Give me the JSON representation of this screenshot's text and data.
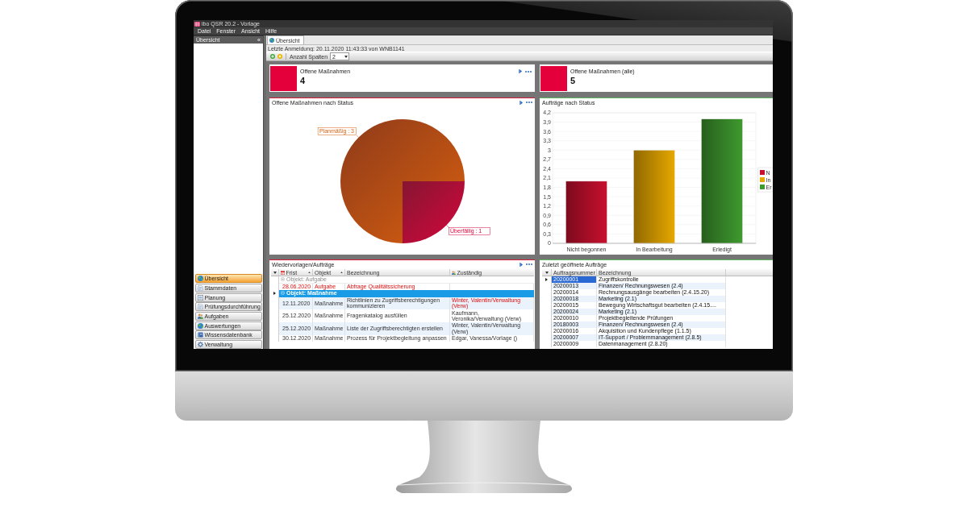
{
  "window": {
    "title": "ibo QSR 20.2 - Vorlage"
  },
  "menu": [
    "Datei",
    "Fenster",
    "Ansicht",
    "Hilfe"
  ],
  "sidebar": {
    "title": "Übersicht",
    "collapse": "«",
    "items": [
      {
        "label": "Übersicht",
        "selected": true
      },
      {
        "label": "Stammdaten",
        "selected": false
      },
      {
        "label": "Planung",
        "selected": false
      },
      {
        "label": "Prüfungsdurchführung",
        "selected": false
      },
      {
        "label": "Aufgaben",
        "selected": false
      },
      {
        "label": "Auswertungen",
        "selected": false
      },
      {
        "label": "Wissensdatenbank",
        "selected": false
      },
      {
        "label": "Verwaltung",
        "selected": false
      }
    ]
  },
  "tabs": [
    {
      "label": "Übersicht",
      "selected": true
    }
  ],
  "login_info": "Letzte Anmeldung: 20.11.2020 11:43:33 von WNB1141",
  "toolbar": {
    "columns_label": "Anzahl Spalten",
    "columns_value": "2"
  },
  "widgets": [
    {
      "kind": "count",
      "title": "Offene Maßnahmen",
      "value": "4",
      "actions": true
    },
    {
      "kind": "count",
      "title": "Offene Maßnahmen (alle)",
      "value": "5",
      "actions": false
    },
    {
      "kind": "chart",
      "title": "Offene Maßnahmen nach Status",
      "color": "#d21c3c",
      "actions": true,
      "chart_data": {
        "type": "pie",
        "categories": [
          "Planmäßig",
          "Überfällig"
        ],
        "values": [
          3,
          1
        ],
        "value_labels": [
          ": 3",
          ": 1"
        ]
      }
    },
    {
      "kind": "chart",
      "title": "Aufträge nach Status",
      "color": "#5cb85c",
      "actions": false,
      "chart_data": {
        "type": "bar",
        "categories": [
          "Nicht begonnen",
          "In Bearbeitung",
          "Erledigt"
        ],
        "values": [
          2,
          3,
          4
        ],
        "ylim": [
          0,
          4.2
        ],
        "grid": true,
        "yticks": [
          {
            "value": 0,
            "label": "0"
          },
          {
            "value": 0.3,
            "label": "0,3"
          },
          {
            "value": 0.6,
            "label": "0,6"
          },
          {
            "value": 0.9,
            "label": "0,9"
          },
          {
            "value": 1.2,
            "label": "1,2"
          },
          {
            "value": 1.5,
            "label": "1,5"
          },
          {
            "value": 1.8,
            "label": "1,8"
          },
          {
            "value": 2.1,
            "label": "2,1"
          },
          {
            "value": 2.4,
            "label": "2,4"
          },
          {
            "value": 2.7,
            "label": "2,7"
          },
          {
            "value": 3,
            "label": "3"
          },
          {
            "value": 3.3,
            "label": "3,3"
          },
          {
            "value": 3.6,
            "label": "3,6"
          },
          {
            "value": 3.9,
            "label": "3,9"
          },
          {
            "value": 4.2,
            "label": "4,2"
          }
        ]
      },
      "legend": [
        {
          "label": "N",
          "color": "#c8102e"
        },
        {
          "label": "In",
          "color": "#e6a800"
        },
        {
          "label": "Er",
          "color": "#3f9a2f"
        }
      ]
    },
    {
      "kind": "grouped_table",
      "title": "Wiedervorlagen/Aufträge",
      "color": "#d21c3c",
      "actions": true,
      "columns": [
        {
          "label": "Frist",
          "sorted": true
        },
        {
          "label": "Objekt",
          "sorted": true
        },
        {
          "label": "Bezeichnung",
          "sorted": false
        },
        {
          "label": "Zuständig",
          "sorted": false
        }
      ],
      "groups": [
        {
          "label": "Objekt: Aufgabe",
          "expanded": true,
          "selected": false,
          "rows": [
            {
              "cells": [
                {
                  "text": "28.06.2020",
                  "alert": true
                },
                {
                  "text": "Aufgabe",
                  "alert": true
                },
                {
                  "text": "Abfrage Qualitätssicherung",
                  "alert": true
                }
              ]
            }
          ]
        },
        {
          "label": "Objekt: Maßnahme",
          "expanded": true,
          "selected": true,
          "rows": [
            {
              "cells": [
                {
                  "text": "12.11.2020",
                  "alert": false
                },
                {
                  "text": "Maßnahme",
                  "alert": false
                },
                {
                  "text": "Richtlinien zu Zugriffsberechtigungen kommunizieren",
                  "alert": false
                },
                {
                  "text": "Winter, Valentin/Verwaltung (Verw)",
                  "alert": true
                }
              ]
            },
            {
              "cells": [
                {
                  "text": "25.12.2020",
                  "alert": false
                },
                {
                  "text": "Maßnahme",
                  "alert": false
                },
                {
                  "text": "Fragenkatalog ausfüllen",
                  "alert": false
                },
                {
                  "text": "Kaufmann, Veronika/Verwaltung (Verw)",
                  "alert": false
                }
              ]
            },
            {
              "cells": [
                {
                  "text": "25.12.2020",
                  "alert": false
                },
                {
                  "text": "Maßnahme",
                  "alert": false
                },
                {
                  "text": "Liste der Zugriffsberechtigten erstellen",
                  "alert": false
                },
                {
                  "text": "Winter, Valentin/Verwaltung (Verw)",
                  "alert": false
                }
              ]
            },
            {
              "cells": [
                {
                  "text": "30.12.2020",
                  "alert": false
                },
                {
                  "text": "Maßnahme",
                  "alert": false
                },
                {
                  "text": "Prozess für Projektbegleitung anpassen",
                  "alert": false
                },
                {
                  "text": "Edgar, Vanessa/Vorlage ()",
                  "alert": false
                }
              ]
            }
          ]
        }
      ]
    },
    {
      "kind": "table",
      "title": "Zuletzt geöffnete Aufträge",
      "color": "#5cb85c",
      "actions": false,
      "columns": [
        "Auftragsnummer",
        "Bezeichnung"
      ],
      "rows": [
        {
          "cells": [
            "20200001",
            "Zugriffskontrolle"
          ],
          "selected": true
        },
        {
          "cells": [
            "20200013",
            "Finanzen/ Rechnungswesen (2.4)"
          ],
          "selected": false
        },
        {
          "cells": [
            "20200014",
            "Rechnungsausgänge bearbeiten (2.4.15.20)"
          ],
          "selected": false
        },
        {
          "cells": [
            "20200018",
            "Marketing (2.1)"
          ],
          "selected": false
        },
        {
          "cells": [
            "20200015",
            "Bewegung Wirtschaftsgut bearbeiten (2.4.15...."
          ],
          "selected": false
        },
        {
          "cells": [
            "20200024",
            "Marketing (2.1)"
          ],
          "selected": false
        },
        {
          "cells": [
            "20200010",
            "Projektbegleitende Prüfungen"
          ],
          "selected": false
        },
        {
          "cells": [
            "20180003",
            "Finanzen/ Rechnungswesen (2.4)"
          ],
          "selected": false
        },
        {
          "cells": [
            "20200016",
            "Akquisition und Kundenpflege (1.1.5)"
          ],
          "selected": false
        },
        {
          "cells": [
            "20200007",
            "IT-Support / Problemmanagement (2.8.5)"
          ],
          "selected": false
        },
        {
          "cells": [
            "20200009",
            "Datenmanagement (2.8.20)"
          ],
          "selected": false
        }
      ]
    }
  ]
}
